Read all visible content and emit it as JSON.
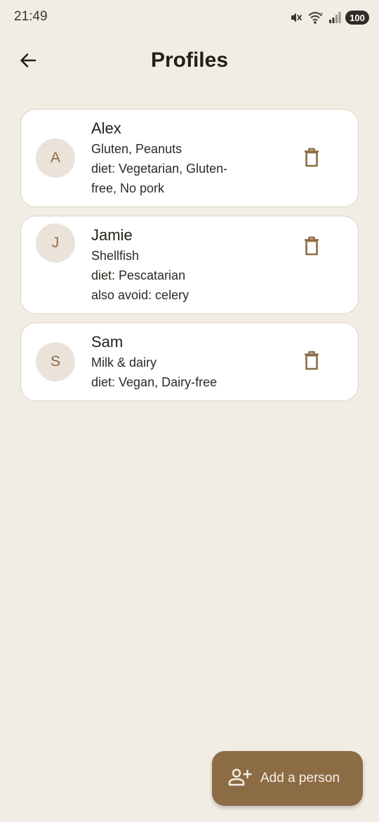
{
  "status_bar": {
    "time": "21:49",
    "battery": "100",
    "icons": [
      "mute-icon",
      "wifi-icon",
      "signal-icon",
      "battery-icon"
    ]
  },
  "header": {
    "title": "Profiles",
    "back_icon": "arrow-back-icon"
  },
  "profiles": [
    {
      "initial": "A",
      "name": "Alex",
      "allergens": "Gluten, Peanuts",
      "lines": [
        "diet: Vegetarian, Gluten-",
        "free, No pork"
      ]
    },
    {
      "initial": "J",
      "name": "Jamie",
      "allergens": "Shellfish",
      "lines": [
        "diet: Pescatarian",
        "also avoid: celery"
      ]
    },
    {
      "initial": "S",
      "name": "Sam",
      "allergens": "Milk & dairy",
      "lines": [
        "diet: Vegan, Dairy-free"
      ]
    }
  ],
  "fab": {
    "label": "Add a person",
    "icon": "person-add-icon"
  },
  "colors": {
    "background": "#f2ede4",
    "card": "#ffffff",
    "card_border": "#ddd2c3",
    "accent": "#8c6c45",
    "avatar_bg": "#ebe3d9",
    "text": "#231f1a"
  }
}
